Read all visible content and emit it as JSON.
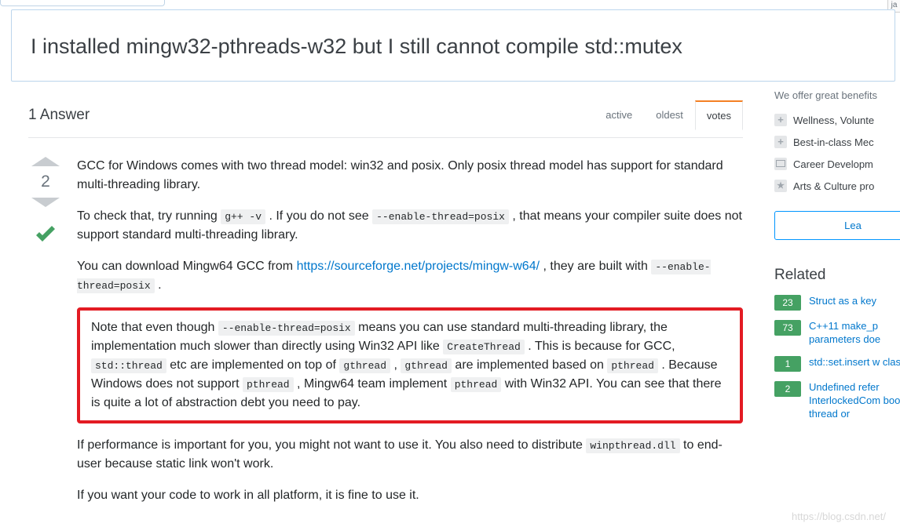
{
  "title": "I installed mingw32-pthreads-w32 but I still cannot compile std::mutex",
  "answers_header": "1 Answer",
  "tabs": {
    "active": "active",
    "oldest": "oldest",
    "votes": "votes"
  },
  "vote_count": "2",
  "post": {
    "p1a": "GCC for Windows comes with two thread model: win32 and posix. Only posix thread model has support for standard multi-threading library.",
    "p2a": "To check that, try running ",
    "p2code1": "g++ -v",
    "p2b": " . If you do not see ",
    "p2code2": "--enable-thread=posix",
    "p2c": " , that means your compiler suite does not support standard multi-threading library.",
    "p3a": "You can download Mingw64 GCC from ",
    "p3link": "https://sourceforge.net/projects/mingw-w64/",
    "p3b": " , they are built with ",
    "p3code": "--enable-thread=posix",
    "p3c": " .",
    "note_a": "Note that even though ",
    "note_code1": "--enable-thread=posix",
    "note_b": " means you can use standard multi-threading library, the implementation much slower than directly using Win32 API like ",
    "note_code2": "CreateThread",
    "note_c": " . This is because for GCC, ",
    "note_code3": "std::thread",
    "note_d": " etc are implemented on top of ",
    "note_code4": "gthread",
    "note_e": " , ",
    "note_code5": "gthread",
    "note_f": " are implemented based on ",
    "note_code6": "pthread",
    "note_g": " . Because Windows does not support ",
    "note_code7": "pthread",
    "note_h": " , Mingw64 team implement ",
    "note_code8": "pthread",
    "note_i": " with Win32 API. You can see that there is quite a lot of abstraction debt you need to pay.",
    "p5a": "If performance is important for you, you might not want to use it. You also need to distribute ",
    "p5code": "winpthread.dll",
    "p5b": " to end-user because static link won't work.",
    "p6": "If you want your code to work in all platform, it is fine to use it."
  },
  "sidebar": {
    "benefits_head": "We offer great benefits",
    "b1": "Wellness, Volunte",
    "b2": "Best-in-class Mec",
    "b3": "Career Developm",
    "b4": "Arts & Culture pro",
    "learn": "Lea",
    "related_head": "Related",
    "r1_badge": "23",
    "r1_text": "Struct as a key",
    "r2_badge": "73",
    "r2_text": "C++11 make_p parameters doe",
    "r3_badge": "1",
    "r3_text": "std::set.insert w class",
    "r4_badge": "2",
    "r4_text": "Undefined refer InterlockedCom boost thread or"
  },
  "watermark": "https://blog.csdn.net/",
  "topright": "ja"
}
